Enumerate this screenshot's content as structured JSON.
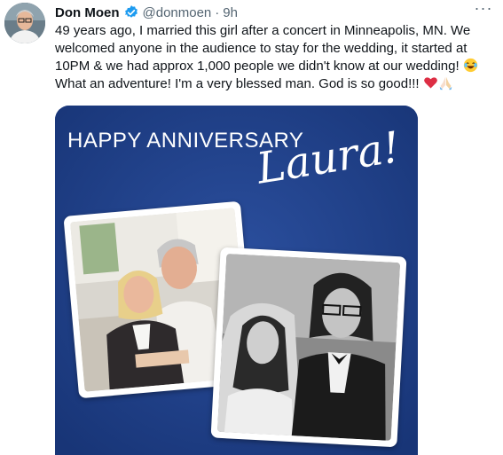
{
  "tweet": {
    "author_name": "Don Moen",
    "handle": "@donmoen",
    "separator": "·",
    "time": "9h",
    "more_label": "···",
    "text_part1": "49 years ago, I married this girl after a concert in Minneapolis, MN. We welcomed anyone in the audience to stay for the wedding, it started at 10PM & we had approx 1,000 people we didn't know at our wedding! ",
    "text_part2": " What an adventure! I'm a very blessed man. God is so good!!! ",
    "emojis": [
      "face-with-tears-of-joy",
      "red-heart",
      "folded-hands"
    ]
  },
  "media": {
    "headline": "HAPPY ANNIVERSARY",
    "script_name": "Laura!",
    "background_color": "#1f3f8a"
  },
  "colors": {
    "verified": "#1d9bf0",
    "secondary_text": "#536471",
    "primary_text": "#0f1419"
  }
}
